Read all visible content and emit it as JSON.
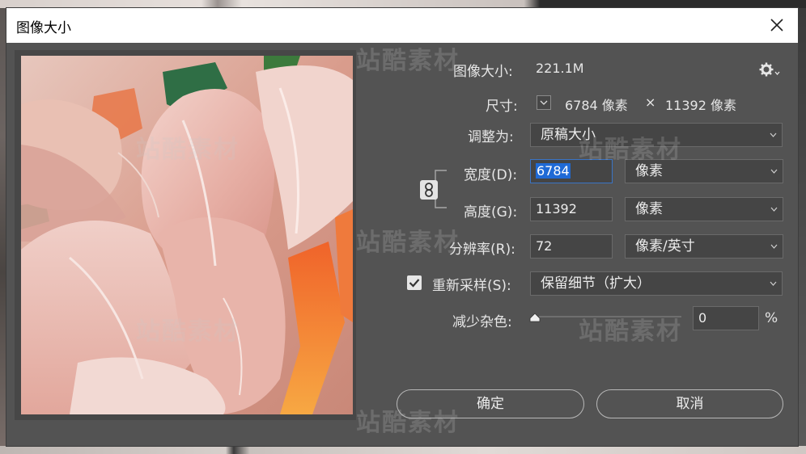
{
  "dialog": {
    "title": "图像大小",
    "image_size_label": "图像大小:",
    "image_size_value": "221.1M",
    "dimensions_label": "尺寸:",
    "dimensions_width": "6784 像素",
    "dimensions_sep": "×",
    "dimensions_height": "11392 像素",
    "fit_to_label": "调整为:",
    "fit_to_value": "原稿大小",
    "width_label": "宽度(D):",
    "width_value": "6784",
    "width_unit": "像素",
    "height_label": "高度(G):",
    "height_value": "11392",
    "height_unit": "像素",
    "resolution_label": "分辨率(R):",
    "resolution_value": "72",
    "resolution_unit": "像素/英寸",
    "resample_label": "重新采样(S):",
    "resample_checked": true,
    "resample_value": "保留细节（扩大）",
    "reduce_noise_label": "减少杂色:",
    "reduce_noise_value": "0",
    "reduce_noise_unit": "%",
    "ok_label": "确定",
    "cancel_label": "取消"
  },
  "watermark_text": "站酷素材",
  "icons": {
    "close": "close-icon",
    "settings": "gear-icon",
    "link": "chain-link-icon",
    "dropdown": "chevron-down-icon",
    "checkbox": "checkmark-icon",
    "slider": "slider-thumb-icon"
  },
  "colors": {
    "dialog_bg": "#535353",
    "field_bg": "#454545",
    "selection": "#1f6ad6",
    "text": "#e6e6e6"
  }
}
